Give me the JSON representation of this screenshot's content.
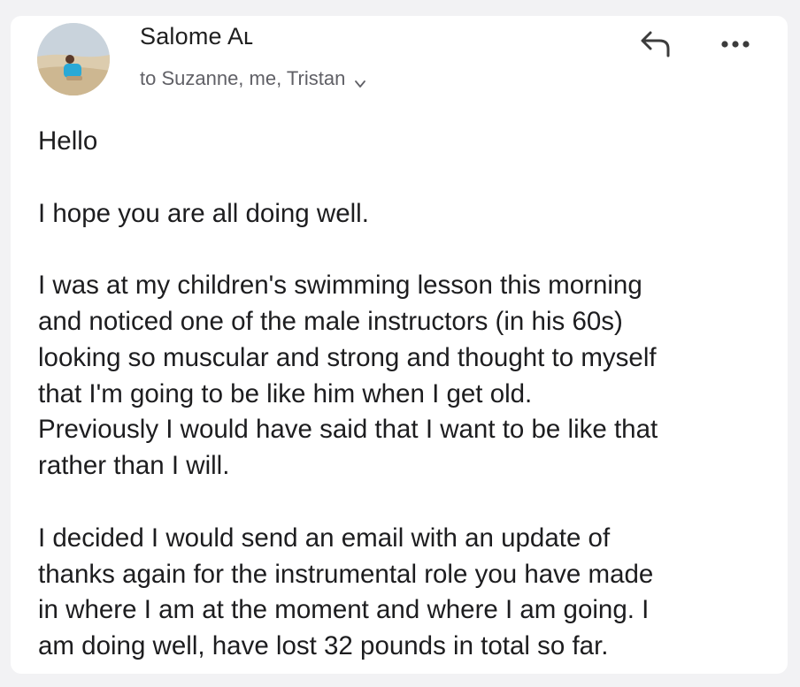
{
  "email": {
    "sender": "Salome Aʟ",
    "recipients": "to Suzanne, me, Tristan",
    "paragraphs": [
      "Hello",
      "I hope you are all doing well.",
      "I was at my children's swimming lesson this morning\nand noticed one of the male instructors (in his 60s)\nlooking so muscular and strong and thought to myself\nthat I'm going to be like him when I get old.\nPreviously I would have said that I want to be like that\nrather than I will.",
      "I decided I would send an email with an update of\nthanks again for the instrumental role you have made\nin where I am at the moment and where I am going. I\nam doing well, have lost 32 pounds in total so far."
    ]
  },
  "icons": {
    "reply": "reply-icon",
    "more": "more-options-icon",
    "expand": "chevron-down-icon",
    "avatar": "avatar"
  }
}
